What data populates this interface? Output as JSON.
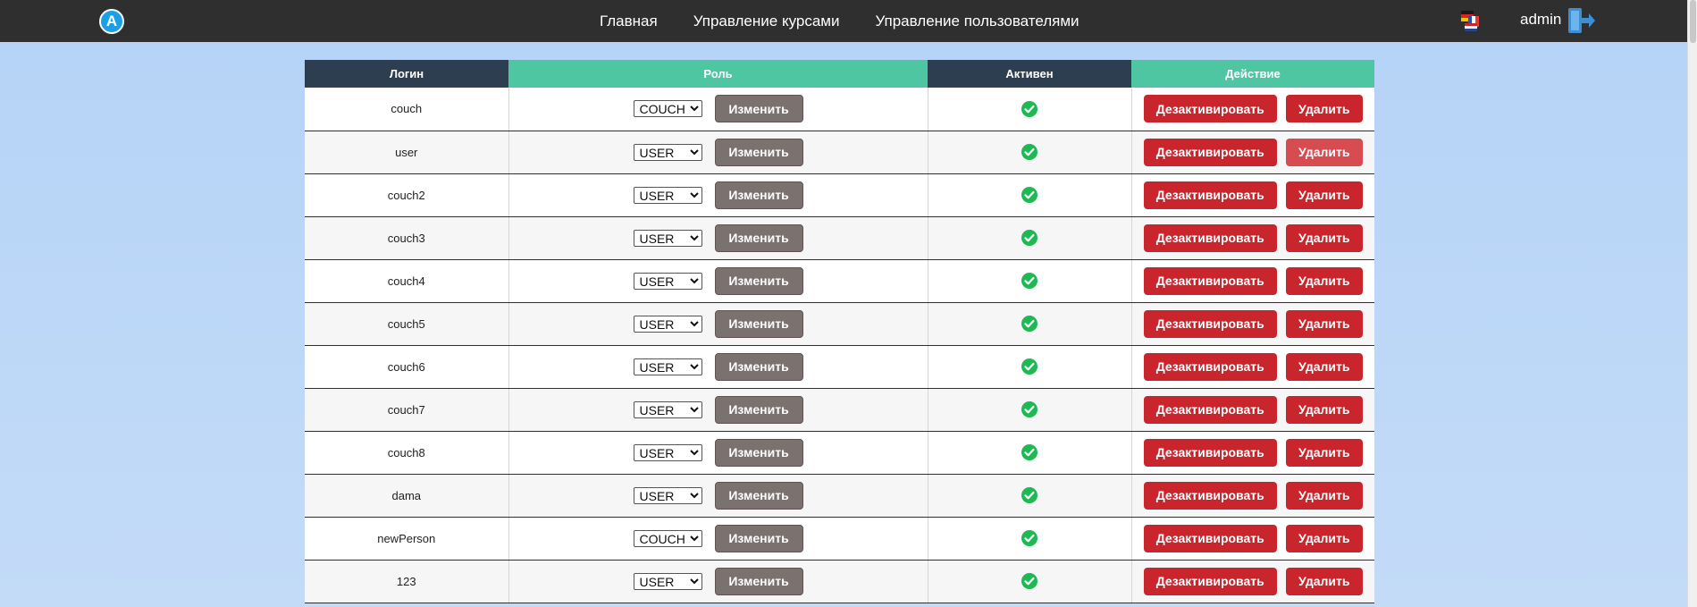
{
  "nav": {
    "logo_letter": "A",
    "links": [
      "Главная",
      "Управление курсами",
      "Управление пользователями"
    ],
    "username": "admin"
  },
  "table": {
    "headers": [
      "Логин",
      "Роль",
      "Активен",
      "Действие"
    ],
    "edit_label": "Изменить",
    "deactivate_label": "Дезактивировать",
    "delete_label": "Удалить",
    "role_options": [
      "COUCH",
      "USER"
    ],
    "rows": [
      {
        "login": "couch",
        "role": "COUCH",
        "active": true
      },
      {
        "login": "user",
        "role": "USER",
        "active": true
      },
      {
        "login": "couch2",
        "role": "USER",
        "active": true
      },
      {
        "login": "couch3",
        "role": "USER",
        "active": true
      },
      {
        "login": "couch4",
        "role": "USER",
        "active": true
      },
      {
        "login": "couch5",
        "role": "USER",
        "active": true
      },
      {
        "login": "couch6",
        "role": "USER",
        "active": true
      },
      {
        "login": "couch7",
        "role": "USER",
        "active": true
      },
      {
        "login": "couch8",
        "role": "USER",
        "active": true
      },
      {
        "login": "dama",
        "role": "USER",
        "active": true
      },
      {
        "login": "newPerson",
        "role": "COUCH",
        "active": true
      },
      {
        "login": "123",
        "role": "USER",
        "active": true
      }
    ]
  },
  "icons": {
    "logo": "app-logo-icon",
    "language": "language-flag-icon",
    "logout": "logout-icon",
    "active": "check-circle-icon"
  },
  "colors": {
    "navbar": "#2f2f2f",
    "header_dark": "#2c3e50",
    "header_green": "#4fc6a2",
    "danger": "#c8262c",
    "edit_button": "#7b716f",
    "active_check": "#1db954"
  }
}
